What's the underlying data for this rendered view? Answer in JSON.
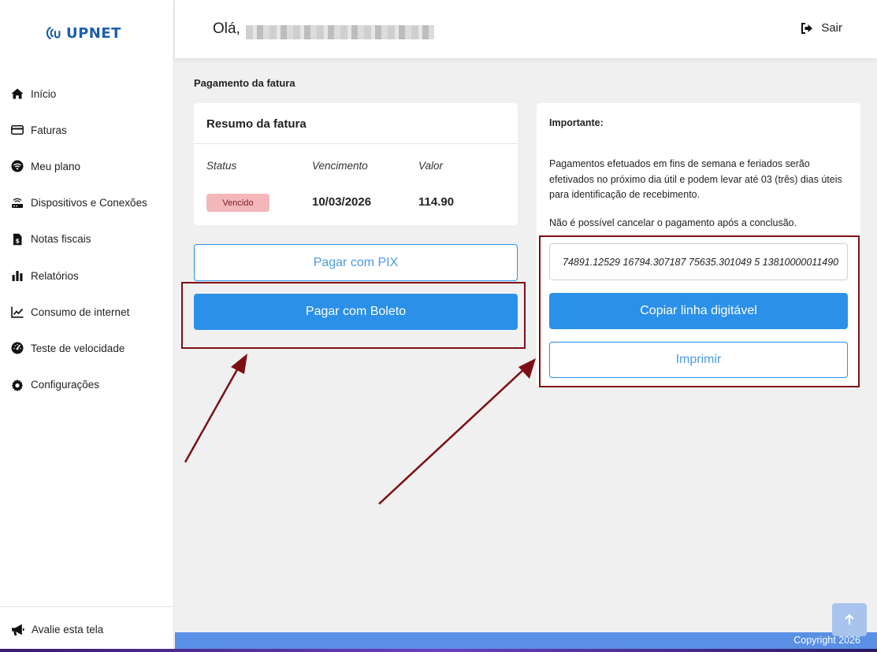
{
  "brand": {
    "name": "UPNET",
    "color": "#1d5fa8"
  },
  "sidebar": {
    "items": [
      {
        "label": "Início",
        "icon": "home-icon"
      },
      {
        "label": "Faturas",
        "icon": "credit-card-icon"
      },
      {
        "label": "Meu plano",
        "icon": "wifi-icon"
      },
      {
        "label": "Dispositivos e Conexões",
        "icon": "router-icon"
      },
      {
        "label": "Notas fiscais",
        "icon": "invoice-icon"
      },
      {
        "label": "Relatórios",
        "icon": "bar-chart-icon"
      },
      {
        "label": "Consumo de internet",
        "icon": "line-chart-icon"
      },
      {
        "label": "Teste de velocidade",
        "icon": "speedometer-icon"
      },
      {
        "label": "Configurações",
        "icon": "gear-icon"
      }
    ],
    "footer_label": "Avalie esta tela"
  },
  "header": {
    "greeting": "Olá,",
    "logout_label": "Sair"
  },
  "main": {
    "title": "Pagamento da fatura",
    "summary": {
      "title": "Resumo da fatura",
      "columns": [
        "Status",
        "Vencimento",
        "Valor"
      ],
      "status": "Vencido",
      "due_date": "10/03/2026",
      "amount": "114.90"
    },
    "buttons": {
      "pix": "Pagar com PIX",
      "boleto": "Pagar com Boleto"
    },
    "important": {
      "title": "Importante:",
      "paragraph1": "Pagamentos efetuados em fins de semana e feriados serão efetivados no próximo dia útil e podem levar até 03 (três) dias úteis para identificação de recebimento.",
      "paragraph2": "Não é possível cancelar o pagamento após a conclusão.",
      "barcode": "74891.12529 16794.307187 75635.301049 5 13810000011490",
      "copy_label": "Copiar linha digitável",
      "print_label": "Imprimir"
    }
  },
  "footer": {
    "copyright": "Copyright 2026"
  },
  "colors": {
    "primary": "#2b90e8",
    "highlight": "#7d0f14",
    "badge_bg": "#f3b7bb",
    "footer": "#5a8fe6"
  }
}
